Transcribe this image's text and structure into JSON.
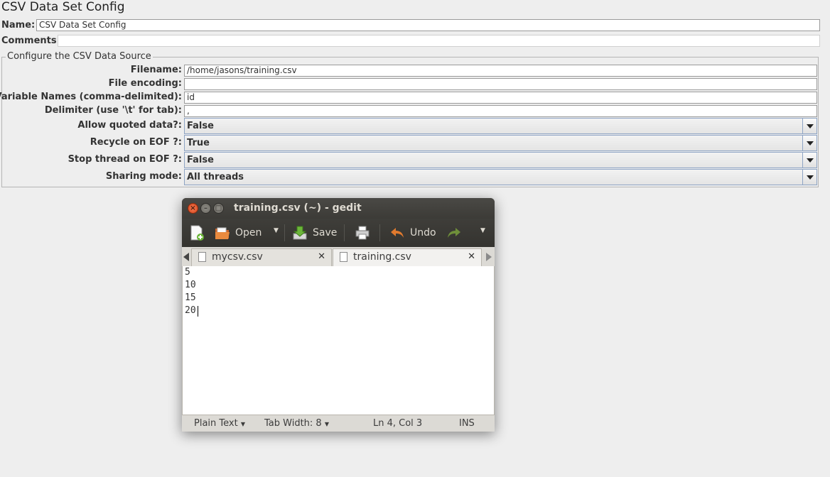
{
  "panel": {
    "title": "CSV Data Set Config",
    "name_label": "Name:",
    "name_value": "CSV Data Set Config",
    "comments_label": "Comments:",
    "comments_value": "",
    "group_title": "Configure the CSV Data Source",
    "fields": [
      {
        "label": "Filename:",
        "value": "/home/jasons/training.csv"
      },
      {
        "label": "File encoding:",
        "value": ""
      },
      {
        "label": "Variable Names (comma-delimited):",
        "value": "id"
      },
      {
        "label": "Delimiter (use '\\t' for tab):",
        "value": ","
      }
    ],
    "combos": [
      {
        "label": "Allow quoted data?:",
        "value": "False"
      },
      {
        "label": "Recycle on EOF ?:",
        "value": "True"
      },
      {
        "label": "Stop thread on EOF ?:",
        "value": "False"
      },
      {
        "label": "Sharing mode:",
        "value": "All threads"
      }
    ]
  },
  "gedit": {
    "title": "training.csv (~) - gedit",
    "toolbar": {
      "open_label": "Open",
      "save_label": "Save",
      "undo_label": "Undo"
    },
    "tabs": [
      {
        "label": "mycsv.csv",
        "active": false
      },
      {
        "label": "training.csv",
        "active": true
      }
    ],
    "lines": [
      "5",
      "10",
      "15",
      "20"
    ],
    "status": {
      "language": "Plain Text",
      "tab_width": "Tab Width: 8",
      "position": "Ln 4, Col 3",
      "mode": "INS"
    }
  },
  "colors": {
    "titlebar": "#3c3b37",
    "close_button": "#e05a2b",
    "combo_border": "#8ea4c4"
  }
}
